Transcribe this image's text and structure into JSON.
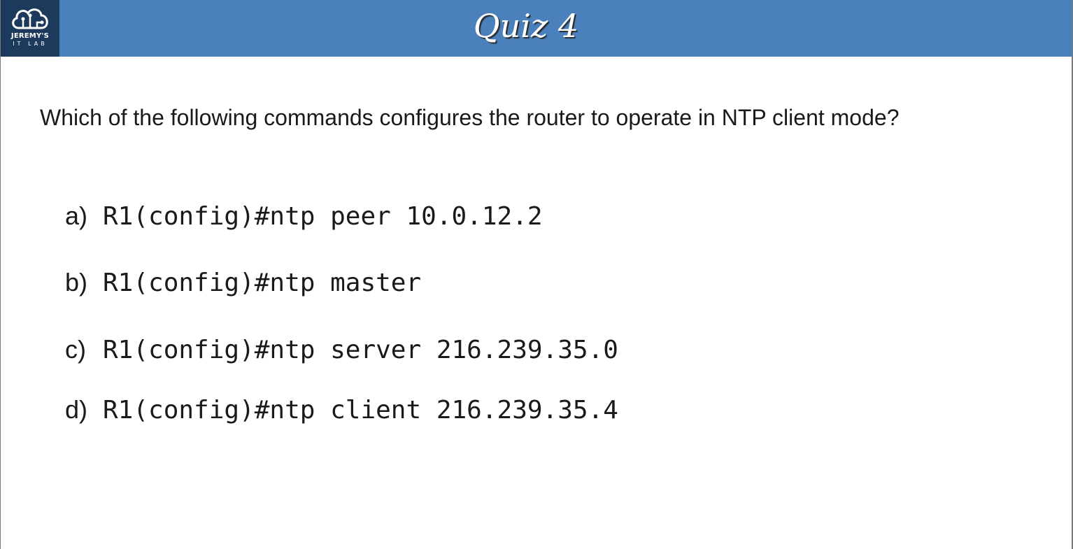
{
  "header": {
    "logo": {
      "line1": "JEREMY'S",
      "line2": "IT LAB",
      "icon": "cloud-circuit-icon"
    },
    "title": "Quiz 4",
    "colors": {
      "header_bg": "#4a81bc",
      "logo_bg": "#1d3a5c"
    }
  },
  "question": {
    "text": "Which of the following commands configures the router to operate in NTP client mode?"
  },
  "options": [
    {
      "letter": "a)",
      "command": "R1(config)#ntp peer 10.0.12.2"
    },
    {
      "letter": "b)",
      "command": "R1(config)#ntp master"
    },
    {
      "letter": "c)",
      "command": "R1(config)#ntp server 216.239.35.0"
    },
    {
      "letter": "d)",
      "command": "R1(config)#ntp client 216.239.35.4"
    }
  ]
}
